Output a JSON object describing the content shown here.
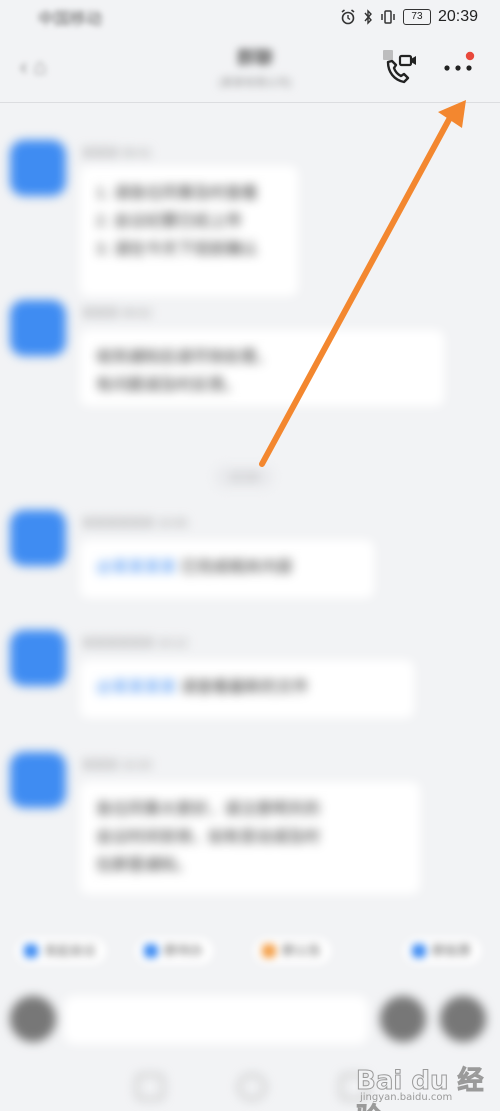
{
  "status_bar": {
    "carrier": "中国移动",
    "battery_level": "73",
    "time": "20:39"
  },
  "header": {
    "title": "群聊",
    "subtitle": "(某某有限公司)",
    "call_icon": "voice-video-call-icon",
    "more_icon": "more-dots-icon",
    "more_badge_color": "#e8483b"
  },
  "messages": [
    {
      "sender": "某某某 09:41",
      "lines": [
        "1. 请各位同事及时查看",
        "2. 会议纪要已经上传",
        "3. 请在今天下班前确认"
      ]
    },
    {
      "sender": "某某某 09:52",
      "lines": [
        "收到通知后请尽快处理，",
        "有问题请及时反馈。"
      ]
    },
    {
      "sender": "某某某某某某 10:05",
      "link": "@某某某某",
      "lines": [
        "已完成相关内容"
      ]
    },
    {
      "sender": "某某某某某某 10:12",
      "link": "@某某某某",
      "lines": [
        "请查看最新的文件"
      ]
    },
    {
      "sender": "某某某 10:20",
      "lines": [
        "各位同事大家好，请注意明天的",
        "会议时间安排，如有变动请及时",
        "在群里通知。"
      ]
    }
  ],
  "time_pill": "10:00",
  "quick_actions": [
    "发起会议",
    "群待办",
    "群公告",
    "群投票"
  ],
  "watermark": {
    "logo": "Bai du 经验",
    "url": "jingyan.baidu.com"
  },
  "colors": {
    "accent": "#3f8cf2",
    "annotation_arrow": "#f3872f"
  }
}
